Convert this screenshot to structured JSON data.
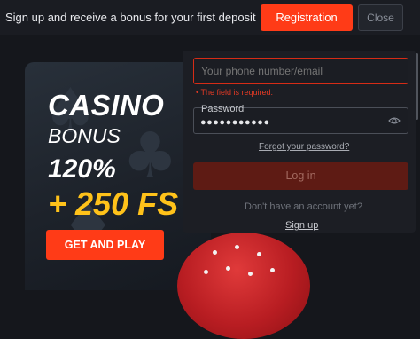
{
  "topbar": {
    "message": "Sign up and receive a bonus for your first deposit",
    "register_label": "Registration",
    "close_label": "Close"
  },
  "banner": {
    "title": "CASINO",
    "subtitle": "BONUS",
    "percent": "120%",
    "free_spins": "+ 250 FS",
    "cta_label": "GET AND PLAY"
  },
  "login": {
    "phone_placeholder": "Your phone number/email",
    "error": "The field is required.",
    "password_label": "Password",
    "password_value": "●●●●●●●●●●●",
    "forgot_label": "Forgot your password?",
    "login_label": "Log in",
    "no_account_text": "Don't have an account yet?",
    "signup_label": "Sign up"
  },
  "colors": {
    "accent": "#ff3b17",
    "bonus_yellow": "#ffc21a",
    "error": "#e33a24",
    "background": "#15171c"
  }
}
